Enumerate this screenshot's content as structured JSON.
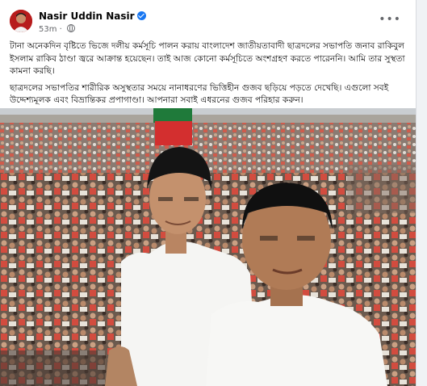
{
  "post": {
    "author": "Nasir Uddin Nasir",
    "time": "53m",
    "paragraphs": [
      "টানা অনেকদিন বৃষ্টিতে ভিজে দলীয় কর্মসূচি পালন করায় বাংলাদেশ জাতীয়তাবাদী ছাত্রদলের সভাপতি জনাব রাকিবুল ইসলাম রাকিব ঠাণ্ডা জ্বরে আক্রান্ত হয়েছেন। তাই আজ কোনো কর্মসূচিতে অংশগ্রহণ করতে পারেননি। আমি তার সুস্থতা কামনা করছি।",
      "ছাত্রদলের সভাপতির শারীরিক অসুস্থতার সময়ে নানাধরণের ভিত্তিহীন গুজব ছড়িয়ে পড়তে দেখেছি। এগুলো সবই উদ্দেশ্যমূলক এবং বিভ্রান্তিকর প্রপাগাণ্ডা। আপনারা সবাই এধরনের গুজব পরিহার করুন।"
    ]
  },
  "colors": {
    "link": "#1877f2",
    "secondary_text": "#65676b",
    "flag_green": "#1f7a3a",
    "flag_red": "#d32f2f"
  },
  "icons": [
    "verified-badge-icon",
    "globe-icon",
    "more-options-icon"
  ]
}
